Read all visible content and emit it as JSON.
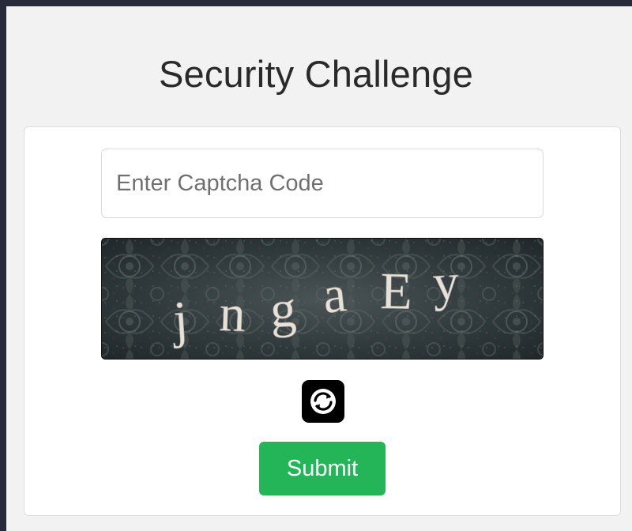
{
  "page": {
    "title": "Security Challenge"
  },
  "form": {
    "captcha_placeholder": "Enter Captcha Code",
    "captcha_value": "",
    "captcha_chars": [
      "j",
      "n",
      "g",
      "a",
      "E",
      "y"
    ],
    "refresh_icon": "refresh-icon",
    "submit_label": "Submit"
  },
  "colors": {
    "background_outer": "#262a3a",
    "page_background": "#f2f2f2",
    "submit_button": "#23b558",
    "refresh_button": "#000000"
  }
}
